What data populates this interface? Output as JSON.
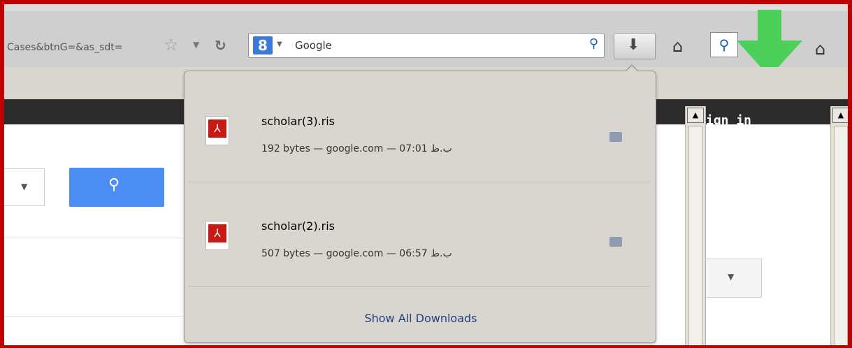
{
  "address_bar": {
    "url_fragment": "Cases&btnG=&as_sdt="
  },
  "search_bar": {
    "engine": "Google",
    "logo_letter": "8"
  },
  "page": {
    "sign_in": "ign in"
  },
  "downloads_panel": {
    "items": [
      {
        "filename": "scholar(3).ris",
        "meta": "192 bytes — google.com — 07:01 ب.ظ"
      },
      {
        "filename": "scholar(2).ris",
        "meta": "507 bytes — google.com — 06:57 ب.ظ"
      }
    ],
    "show_all_label": "Show All Downloads"
  },
  "colors": {
    "frame": "#c00000",
    "arrow": "#3ecf4c",
    "search_button": "#4d8ef5"
  },
  "icons": [
    "star-icon",
    "dropdown-icon",
    "reload-icon",
    "magnifier-icon",
    "download-arrow-icon",
    "home-icon",
    "pdf-icon",
    "folder-icon",
    "scroll-up-icon"
  ]
}
